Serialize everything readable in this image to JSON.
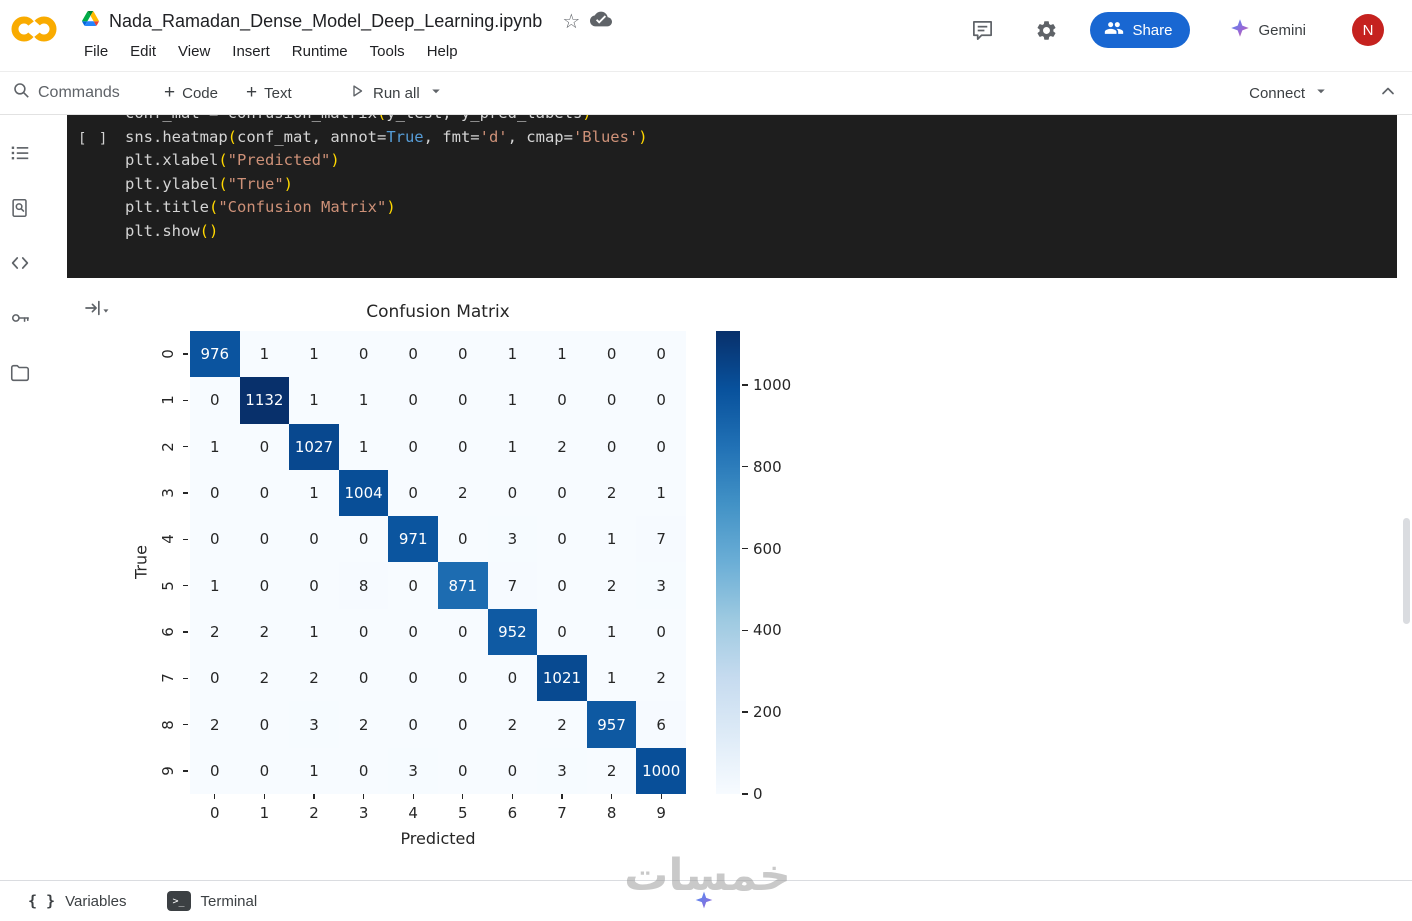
{
  "header": {
    "title": "Nada_Ramadan_Dense_Model_Deep_Learning.ipynb",
    "menus": [
      "File",
      "Edit",
      "View",
      "Insert",
      "Runtime",
      "Tools",
      "Help"
    ],
    "share": "Share",
    "gemini": "Gemini",
    "avatar_initial": "N"
  },
  "toolbar": {
    "commands": "Commands",
    "add_code": "Code",
    "add_text": "Text",
    "run_all": "Run all",
    "connect": "Connect"
  },
  "code_cell": {
    "gutter": "[ ]",
    "token_colors": {
      "pln": "#d4d4d4",
      "kw": "#569cd6",
      "str": "#ce9178",
      "par": "#ffd700"
    },
    "lines": [
      {
        "tokens": [
          [
            "conf_mat = confusion_matrix",
            "pln"
          ],
          [
            "(",
            "par"
          ],
          [
            "y_test, y_pred_labels",
            "pln"
          ],
          [
            ")",
            "par"
          ]
        ]
      },
      {
        "tokens": [
          [
            "sns.heatmap",
            "pln"
          ],
          [
            "(",
            "par"
          ],
          [
            "conf_mat, annot=",
            "pln"
          ],
          [
            "True",
            "kw"
          ],
          [
            ", fmt=",
            "pln"
          ],
          [
            "'d'",
            "str"
          ],
          [
            ", cmap=",
            "pln"
          ],
          [
            "'Blues'",
            "str"
          ],
          [
            ")",
            "par"
          ]
        ]
      },
      {
        "tokens": [
          [
            "plt.xlabel",
            "pln"
          ],
          [
            "(",
            "par"
          ],
          [
            "\"Predicted\"",
            "str"
          ],
          [
            ")",
            "par"
          ]
        ]
      },
      {
        "tokens": [
          [
            "plt.ylabel",
            "pln"
          ],
          [
            "(",
            "par"
          ],
          [
            "\"True\"",
            "str"
          ],
          [
            ")",
            "par"
          ]
        ]
      },
      {
        "tokens": [
          [
            "plt.title",
            "pln"
          ],
          [
            "(",
            "par"
          ],
          [
            "\"Confusion Matrix\"",
            "str"
          ],
          [
            ")",
            "par"
          ]
        ]
      },
      {
        "tokens": [
          [
            "plt.show",
            "pln"
          ],
          [
            "(",
            "par"
          ],
          [
            ")",
            "par"
          ]
        ]
      }
    ]
  },
  "chart_data": {
    "type": "heatmap",
    "title": "Confusion Matrix",
    "xlabel": "Predicted",
    "ylabel": "True",
    "x_ticks": [
      "0",
      "1",
      "2",
      "3",
      "4",
      "5",
      "6",
      "7",
      "8",
      "9"
    ],
    "y_ticks": [
      "0",
      "1",
      "2",
      "3",
      "4",
      "5",
      "6",
      "7",
      "8",
      "9"
    ],
    "matrix": [
      [
        976,
        1,
        1,
        0,
        0,
        0,
        1,
        1,
        0,
        0
      ],
      [
        0,
        1132,
        1,
        1,
        0,
        0,
        1,
        0,
        0,
        0
      ],
      [
        1,
        0,
        1027,
        1,
        0,
        0,
        1,
        2,
        0,
        0
      ],
      [
        0,
        0,
        1,
        1004,
        0,
        2,
        0,
        0,
        2,
        1
      ],
      [
        0,
        0,
        0,
        0,
        971,
        0,
        3,
        0,
        1,
        7
      ],
      [
        1,
        0,
        0,
        8,
        0,
        871,
        7,
        0,
        2,
        3
      ],
      [
        2,
        2,
        1,
        0,
        0,
        0,
        952,
        0,
        1,
        0
      ],
      [
        0,
        2,
        2,
        0,
        0,
        0,
        0,
        1021,
        1,
        2
      ],
      [
        2,
        0,
        3,
        2,
        0,
        0,
        2,
        2,
        957,
        6
      ],
      [
        0,
        0,
        1,
        0,
        3,
        0,
        0,
        3,
        2,
        1000
      ]
    ],
    "vmin": 0,
    "vmax": 1132,
    "colormap": "Blues",
    "colorbar_ticks": [
      0,
      200,
      400,
      600,
      800,
      1000
    ],
    "legend_position": "right"
  },
  "footer": {
    "variables": "Variables",
    "terminal": "Terminal"
  },
  "watermark": "خمسات",
  "colors": {
    "accent_blue": "#1967d2",
    "avatar_red": "#c5221f",
    "logo_orange": "#F9AB00"
  }
}
